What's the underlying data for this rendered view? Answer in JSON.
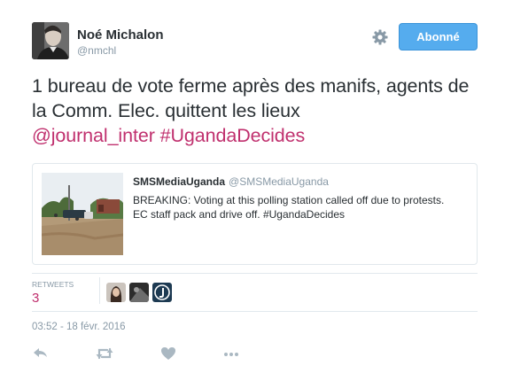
{
  "author": {
    "name": "Noé Michalon",
    "handle": "@nmchl",
    "avatar_icon": "user-avatar"
  },
  "header": {
    "settings_icon": "gear-icon",
    "follow_label": "Abonné"
  },
  "tweet": {
    "text": "1 bureau de vote ferme après des manifs, agents de la Comm. Elec. quittent les lieux",
    "mention": "@journal_inter",
    "hashtag": "#UgandaDecides",
    "link_color": "#c0306e"
  },
  "quoted_tweet": {
    "name": "SMSMediaUganda",
    "handle": "@SMSMediaUganda",
    "text": "BREAKING: Voting at this polling station called off due to protests. EC staff pack and drive off. #UgandaDecides"
  },
  "stats": {
    "retweets_label": "RETWEETS",
    "retweets_count": "3"
  },
  "timestamp": "03:52 - 18 févr. 2016",
  "actions": {
    "reply_icon": "reply-icon",
    "retweet_icon": "retweet-icon",
    "like_icon": "heart-icon",
    "more_icon": "more-icon"
  },
  "colors": {
    "accent": "#55acee",
    "muted": "#8899a6",
    "text": "#292f33"
  }
}
